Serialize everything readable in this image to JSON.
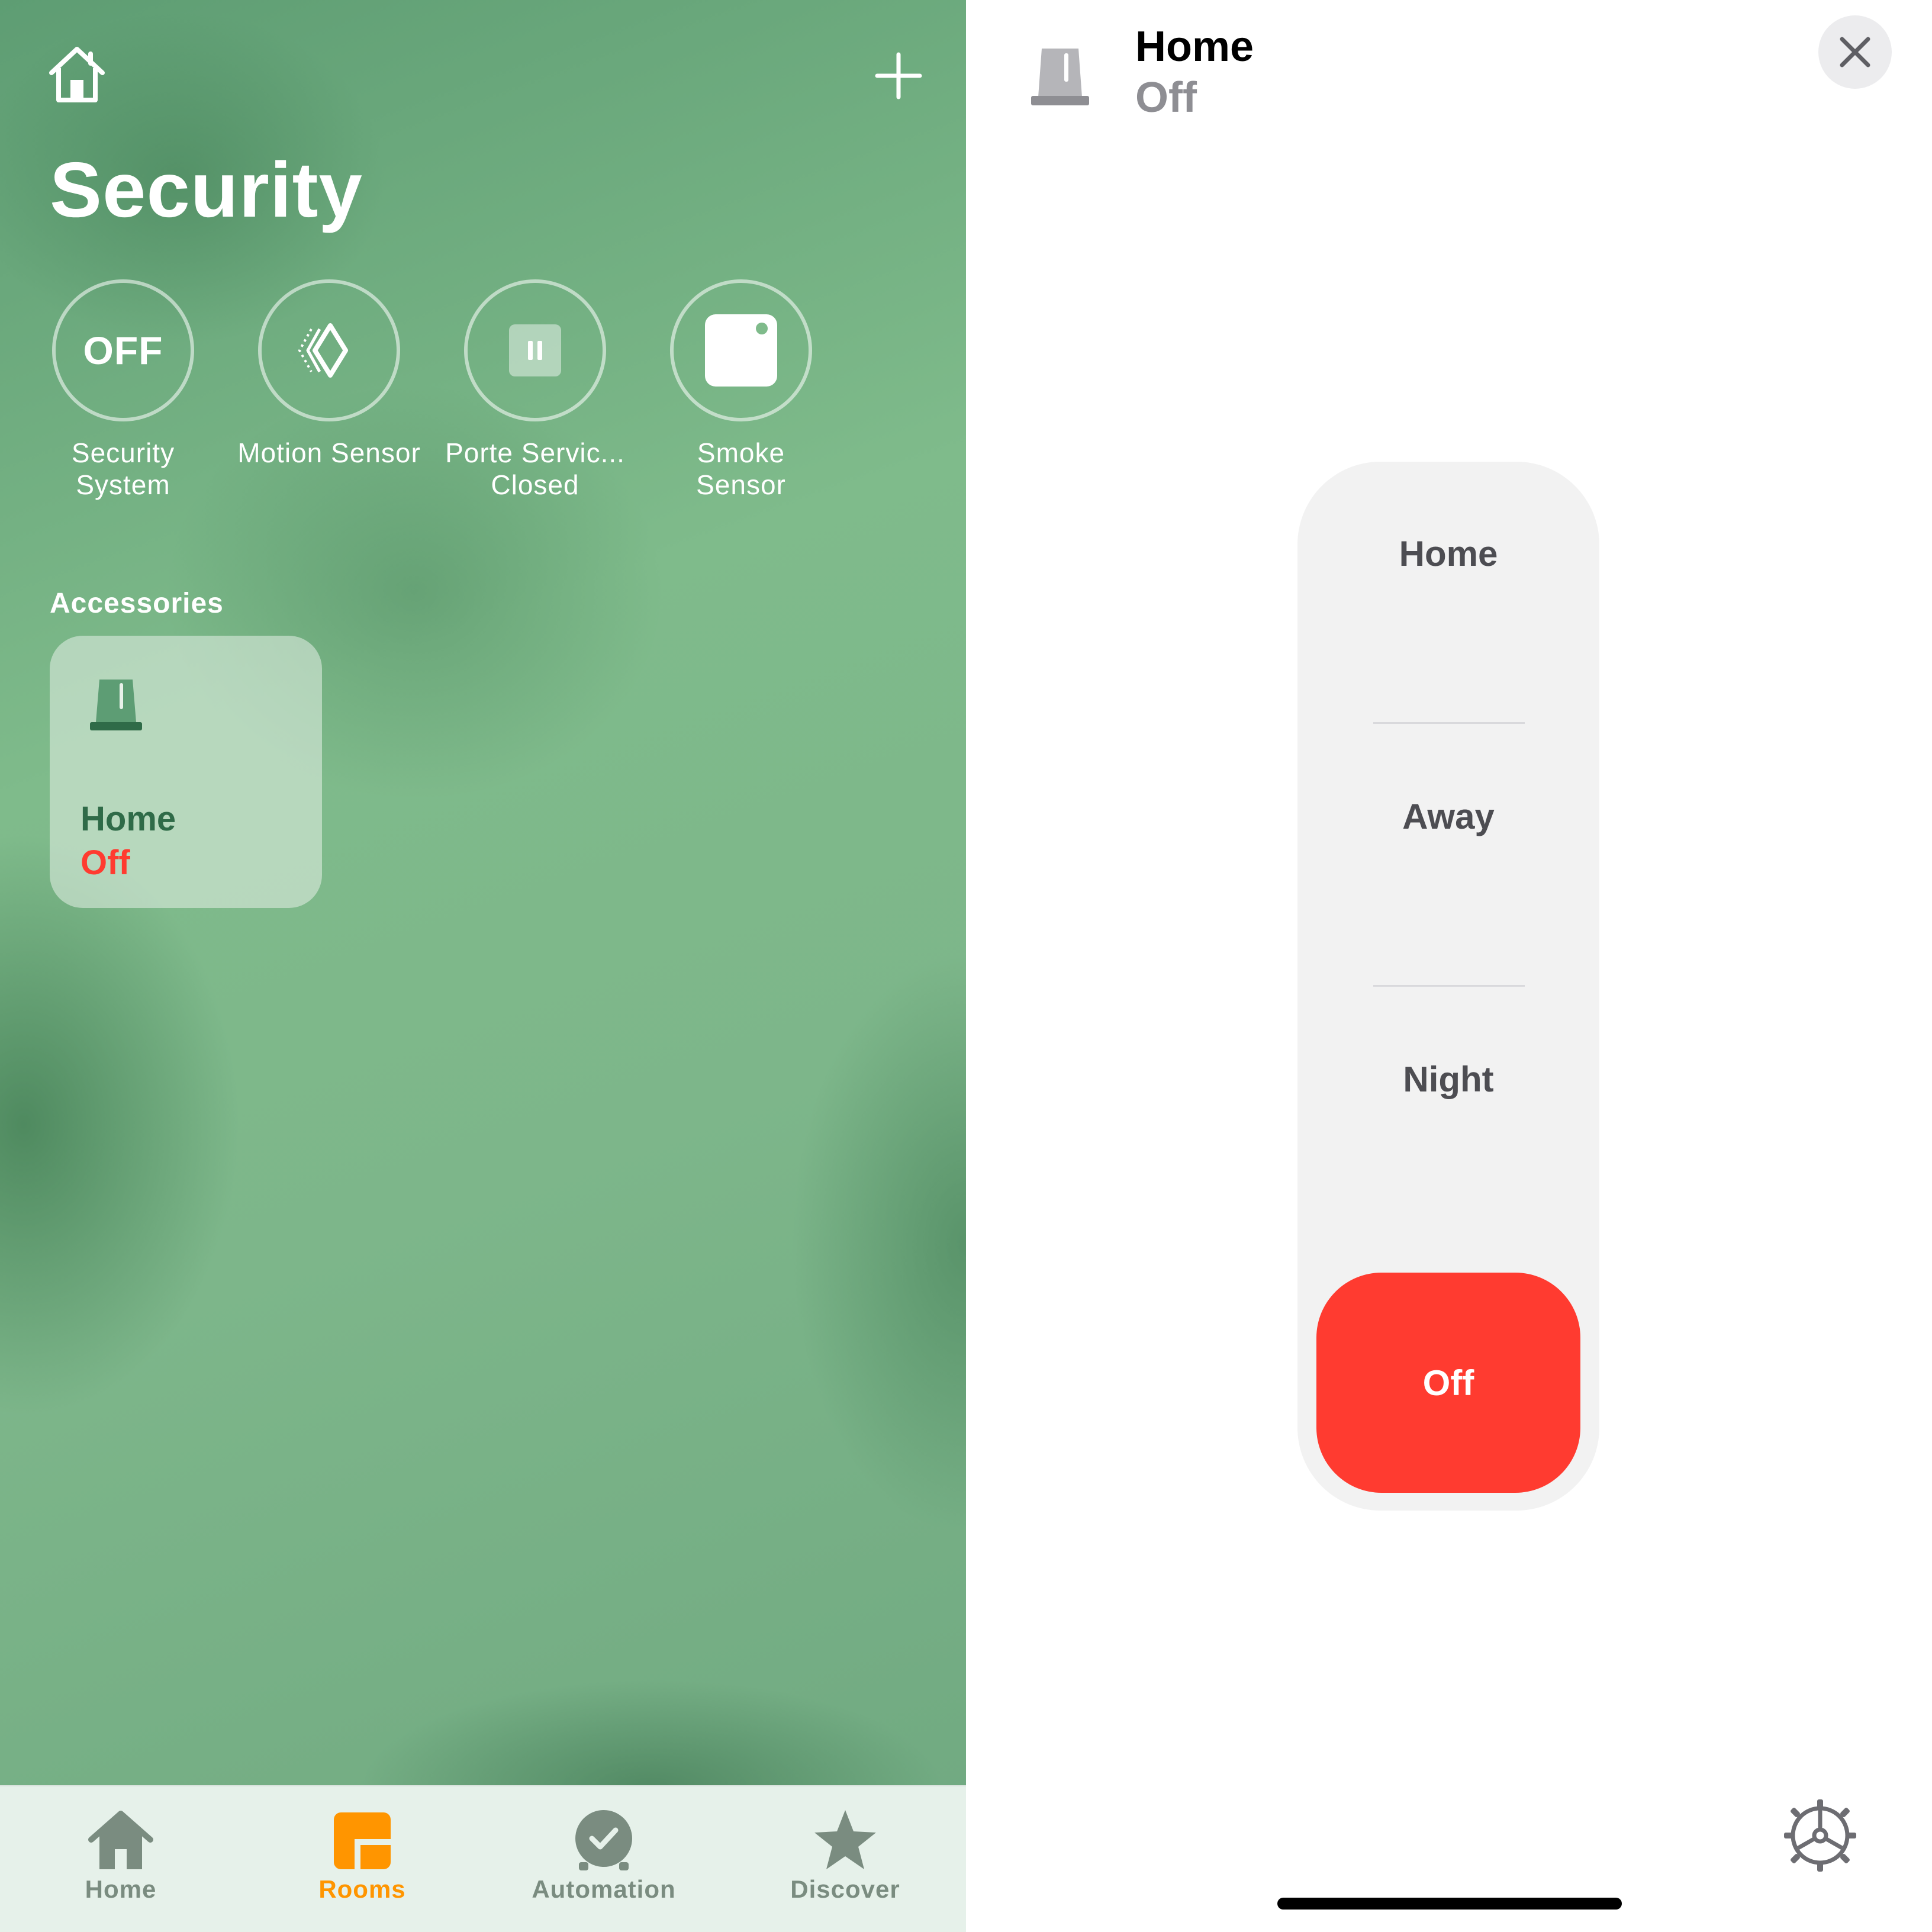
{
  "room": {
    "title": "Security"
  },
  "status_items": [
    {
      "label": "Security System",
      "badge": "OFF",
      "icon": "security-off-badge"
    },
    {
      "label": "Motion Sensor",
      "icon": "motion-sensor-icon"
    },
    {
      "label": "Porte Servic...",
      "sublabel": "Closed",
      "icon": "door-closed-icon"
    },
    {
      "label": "Smoke Sensor",
      "icon": "smoke-sensor-icon"
    }
  ],
  "accessories": {
    "header": "Accessories",
    "tiles": [
      {
        "name": "Home",
        "status": "Off",
        "icon": "security-siren-icon"
      }
    ]
  },
  "tabbar": {
    "tabs": [
      {
        "label": "Home",
        "icon": "house-icon",
        "active": false
      },
      {
        "label": "Rooms",
        "icon": "rooms-icon",
        "active": true
      },
      {
        "label": "Automation",
        "icon": "automation-icon",
        "active": false
      },
      {
        "label": "Discover",
        "icon": "star-icon",
        "active": false
      }
    ]
  },
  "detail": {
    "name": "Home",
    "status": "Off",
    "modes": [
      "Home",
      "Away",
      "Night",
      "Off"
    ],
    "selected_mode": "Off"
  },
  "colors": {
    "accent_active_tab": "#ff9500",
    "inactive_tab": "#7a8c80",
    "alert_red": "#ff3b30",
    "tile_name_green": "#2f6b48"
  }
}
